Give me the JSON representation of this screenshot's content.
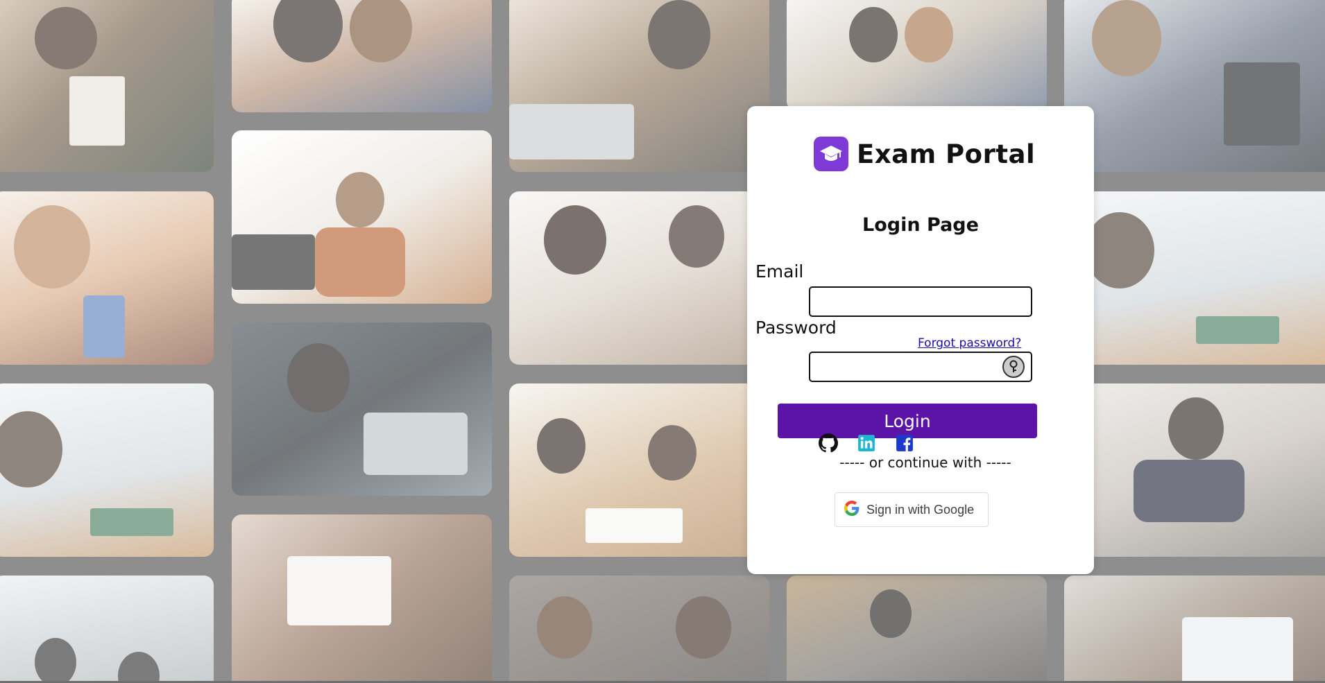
{
  "brand": {
    "name": "Exam Portal",
    "logo_icon": "graduation-cap-icon",
    "logo_color": "#7e3ad6"
  },
  "login": {
    "title": "Login Page",
    "email_label": "Email",
    "email_value": "",
    "password_label": "Password",
    "password_value": "",
    "forgot_label": "Forgot password?",
    "show_password_icon": "key-icon",
    "submit_label": "Login",
    "submit_color": "#5c13a8",
    "divider_text": "----- or continue with -----",
    "google_label": "Sign in with Google"
  },
  "social": [
    {
      "icon": "github-icon",
      "color": "#111111"
    },
    {
      "icon": "linkedin-icon",
      "color": "#1cb6d2"
    },
    {
      "icon": "facebook-icon",
      "color": "#1c39c8"
    }
  ]
}
